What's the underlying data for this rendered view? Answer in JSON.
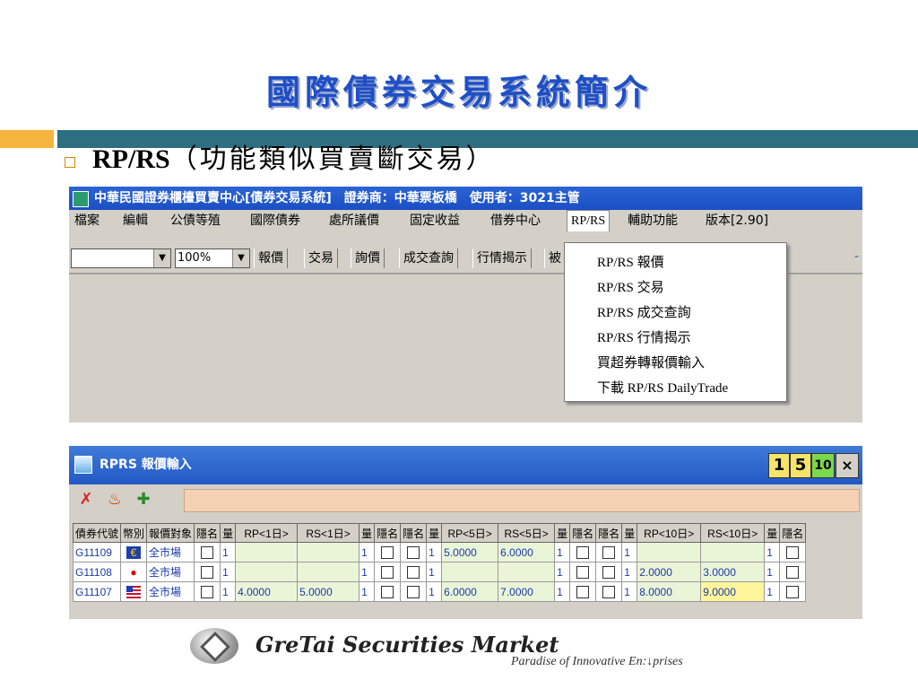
{
  "slide": {
    "title": "國際債券交易系統簡介",
    "bullet_bold": "RP/RS",
    "bullet_rest": "（功能類似買賣斷交易）"
  },
  "window1": {
    "title": "中華民國證券櫃檯買賣中心[債券交易系統]　證券商：中華票板橋　使用者：3021主管",
    "menu": [
      "檔案",
      "編輯",
      "公債等殖",
      "國際債券",
      "處所議價",
      "固定收益",
      "借券中心",
      "RP/RS",
      "輔助功能",
      "版本[2.90]"
    ],
    "zoom": "100%",
    "toolbar_buttons": [
      "報價",
      "交易",
      "詢價",
      "成交查詢",
      "行情揭示",
      "被"
    ],
    "right_mark": "-"
  },
  "dropdown": {
    "items": [
      "RP/RS 報價",
      "RP/RS 交易",
      "RP/RS 成交查詢",
      "RP/RS 行情揭示",
      "買超券轉報價輸入",
      "下載 RP/RS DailyTrade"
    ]
  },
  "window2": {
    "title": "RPRS 報價輸入",
    "num_buttons": [
      "1",
      "5",
      "10"
    ],
    "close": "×",
    "headers": [
      "債券代號",
      "幣別",
      "報價對象",
      "隱名",
      "量",
      "RP<1日>",
      "RS<1日>",
      "量",
      "隱名",
      "隱名",
      "量",
      "RP<5日>",
      "RS<5日>",
      "量",
      "隱名",
      "隱名",
      "量",
      "RP<10日>",
      "RS<10日>",
      "量",
      "隱名"
    ],
    "rows": [
      {
        "code": "G11109",
        "flag": "eu",
        "target": "全市場",
        "q1": "1",
        "rp1": "",
        "rs1": "",
        "q1b": "1",
        "q5": "1",
        "rp5": "5.0000",
        "rs5": "6.0000",
        "q5b": "1",
        "q10": "1",
        "rp10": "",
        "rs10": "",
        "q10b": "1"
      },
      {
        "code": "G11108",
        "flag": "jp",
        "target": "全市場",
        "q1": "1",
        "rp1": "",
        "rs1": "",
        "q1b": "1",
        "q5": "1",
        "rp5": "",
        "rs5": "",
        "q5b": "1",
        "q10": "1",
        "rp10": "2.0000",
        "rs10": "3.0000",
        "q10b": "1"
      },
      {
        "code": "G11107",
        "flag": "us",
        "target": "全市場",
        "q1": "1",
        "rp1": "4.0000",
        "rs1": "5.0000",
        "q1b": "1",
        "q5": "1",
        "rp5": "6.0000",
        "rs5": "7.0000",
        "q5b": "1",
        "q10": "1",
        "rp10": "8.0000",
        "rs10": "9.0000",
        "q10b": "1"
      }
    ]
  },
  "footer": {
    "brand": "GreTai Securities Market",
    "tagline": "Paradise of Innovative En:↓prises"
  },
  "colors": {
    "title_blue": "#1f4fc6",
    "titlebar_blue": "#2b64d4",
    "deco_orange": "#f5b53c",
    "deco_teal": "#2d6f80",
    "highlight_yellow": "#fff59a",
    "cell_green": "#eaf5d8"
  }
}
